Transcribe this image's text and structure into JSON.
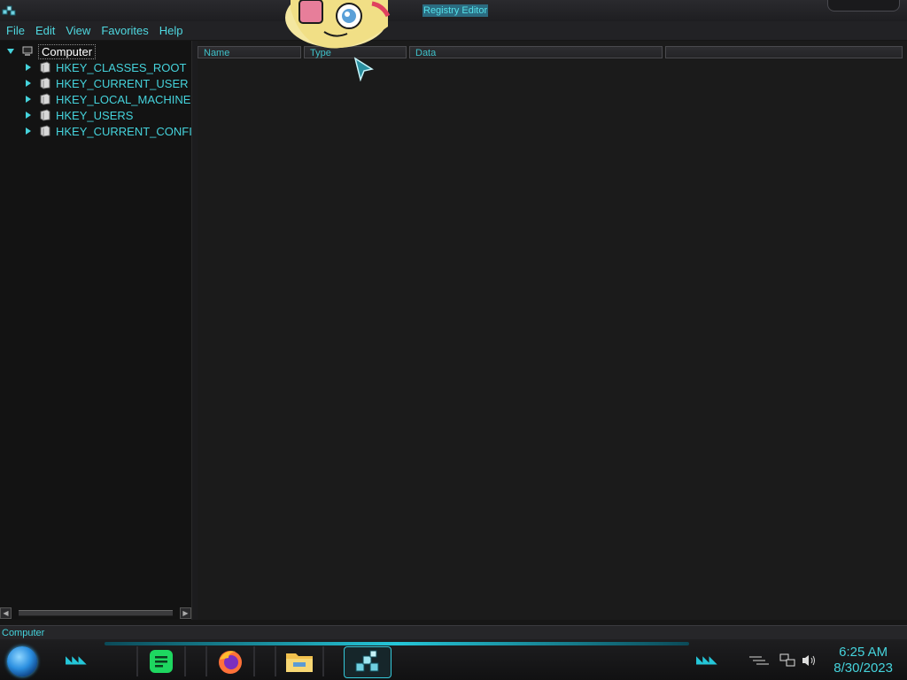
{
  "window": {
    "title": "Registry Editor"
  },
  "menu": {
    "items": [
      "File",
      "Edit",
      "View",
      "Favorites",
      "Help"
    ]
  },
  "tree": {
    "root_label": "Computer",
    "keys": [
      "HKEY_CLASSES_ROOT",
      "HKEY_CURRENT_USER",
      "HKEY_LOCAL_MACHINE",
      "HKEY_USERS",
      "HKEY_CURRENT_CONFI"
    ]
  },
  "list": {
    "columns": [
      "Name",
      "Type",
      "Data"
    ]
  },
  "status": {
    "path": "Computer"
  },
  "taskbar": {
    "apps": [
      {
        "icon": "notes-app-icon",
        "color": "#1ed760"
      },
      {
        "icon": "firefox-icon",
        "color": "#ff7139"
      },
      {
        "icon": "file-explorer-icon",
        "color": "#f2c14e"
      },
      {
        "icon": "registry-editor-icon",
        "color": "#3fc0c8",
        "active": true
      }
    ],
    "time": "6:25 AM",
    "date": "8/30/2023"
  },
  "colors": {
    "accent": "#45d3dc",
    "background": "#161616"
  }
}
